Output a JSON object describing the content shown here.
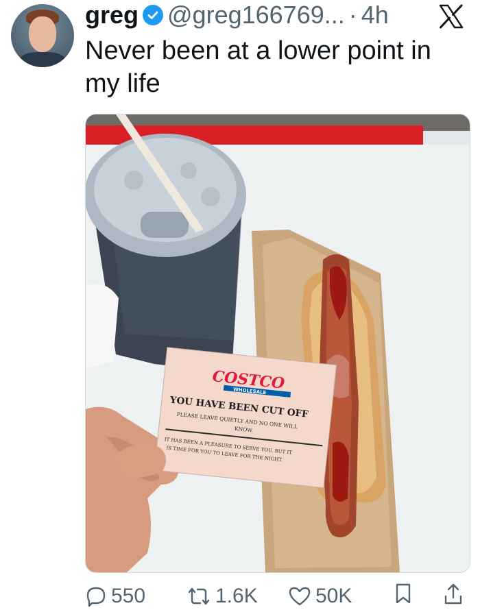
{
  "tweet": {
    "display_name": "greg",
    "handle": "@greg166769...",
    "separator": "·",
    "timestamp": "4h",
    "text": "Never been at a lower point in my life",
    "verified": true
  },
  "media": {
    "card": {
      "brand": "COSTCO",
      "brand_sub": "WHOLESALE",
      "heading": "YOU HAVE BEEN CUT OFF",
      "line1": "PLEASE LEAVE QUIETLY AND NO ONE WILL",
      "line2": "KNOW.",
      "line3": "IT HAS BEEN A PLEASURE TO SERVE YOU. BUT IT",
      "line4": "IS TIME FOR YOU TO LEAVE FOR THE NIGHT."
    }
  },
  "actions": {
    "replies": "550",
    "reposts": "1.6K",
    "likes": "50K"
  },
  "icons": {
    "verified": "verified-badge-icon",
    "platform": "x-logo-icon",
    "reply": "reply-icon",
    "repost": "repost-icon",
    "like": "heart-icon",
    "bookmark": "bookmark-icon",
    "share": "share-icon"
  },
  "colors": {
    "verified_blue": "#1d9bf0",
    "muted_text": "#536471",
    "costco_red": "#e31837",
    "costco_blue": "#005daa"
  }
}
